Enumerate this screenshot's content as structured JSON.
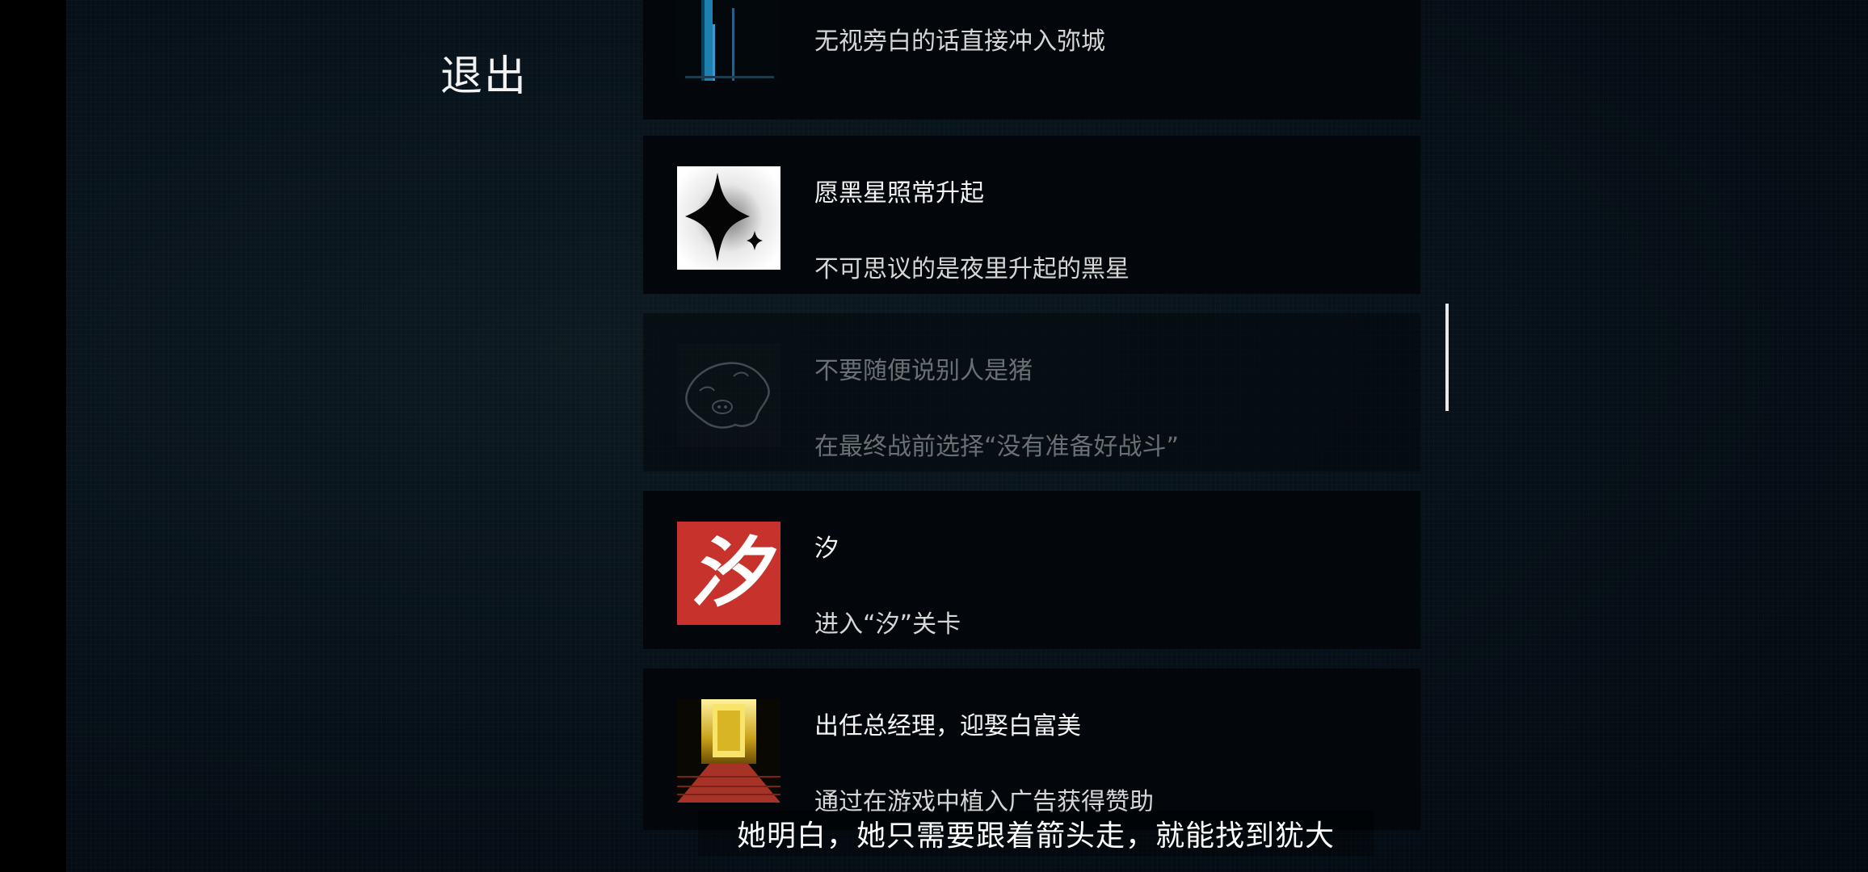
{
  "exit_label": "退出",
  "achievements": [
    {
      "title": "",
      "description": "无视旁白的话直接冲入弥城",
      "icon": "door-icon",
      "locked": false
    },
    {
      "title": "愿黑星照常升起",
      "description": "不可思议的是夜里升起的黑星",
      "icon": "black-star-icon",
      "locked": false
    },
    {
      "title": "不要随便说别人是猪",
      "description": "在最终战前选择“没有准备好战斗”",
      "icon": "pig-icon",
      "locked": true
    },
    {
      "title": "汐",
      "description": "进入“汐”关卡",
      "icon": "xi-character-icon",
      "icon_text": "汐",
      "locked": false
    },
    {
      "title": "出任总经理，迎娶白富美",
      "description": "通过在游戏中植入广告获得赞助",
      "icon": "golden-doorway-icon",
      "locked": false
    }
  ],
  "subtitle": "她明白，她只需要跟着箭头走，就能找到犹大",
  "colors": {
    "background": "#061018",
    "card": "#03070b",
    "text": "#f4f4f4",
    "xi_red": "#c8322c"
  }
}
